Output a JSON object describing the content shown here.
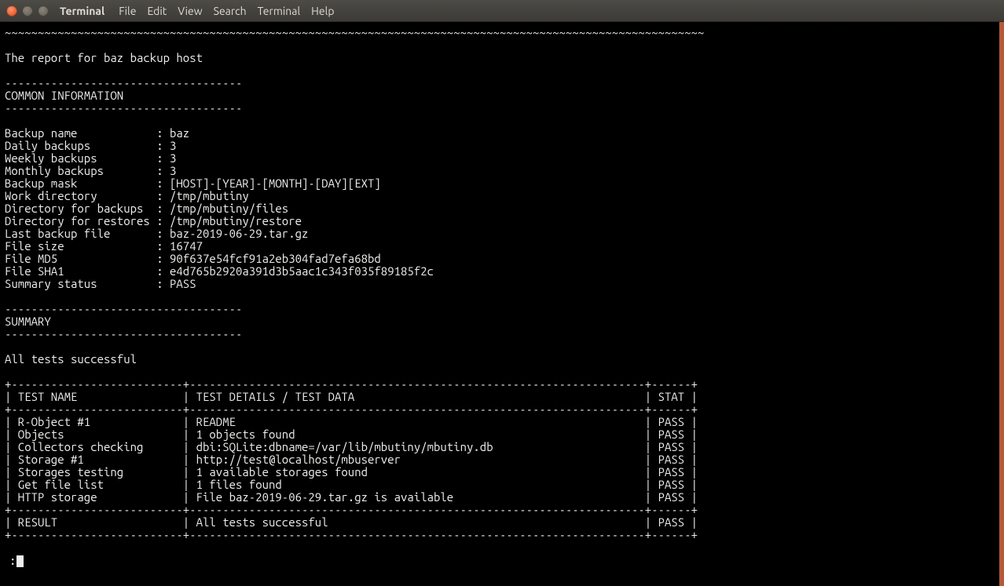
{
  "window": {
    "app_title": "Terminal",
    "menu": [
      "File",
      "Edit",
      "View",
      "Search",
      "Terminal",
      "Help"
    ]
  },
  "report": {
    "tilde_row": "~~~~~~~~~~~~~~~~~~~~~~~~~~~~~~~~~~~~~~~~~~~~~~~~~~~~~~~~~~~~~~~~~~~~~~~~~~~~~~~~~~~~~~~~~~~~~~~~~~~~~~~~~~",
    "title": "The report for baz backup host",
    "section_sep": "------------------------------------",
    "common_header": "COMMON INFORMATION",
    "common_rows": [
      {
        "label": "Backup name",
        "value": "baz"
      },
      {
        "label": "Daily backups",
        "value": "3"
      },
      {
        "label": "Weekly backups",
        "value": "3"
      },
      {
        "label": "Monthly backups",
        "value": "3"
      },
      {
        "label": "Backup mask",
        "value": "[HOST]-[YEAR]-[MONTH]-[DAY][EXT]"
      },
      {
        "label": "Work directory",
        "value": "/tmp/mbutiny"
      },
      {
        "label": "Directory for backups",
        "value": "/tmp/mbutiny/files"
      },
      {
        "label": "Directory for restores",
        "value": "/tmp/mbutiny/restore"
      },
      {
        "label": "Last backup file",
        "value": "baz-2019-06-29.tar.gz"
      },
      {
        "label": "File size",
        "value": "16747"
      },
      {
        "label": "File MD5",
        "value": "90f637e54fcf91a2eb304fad7efa68bd"
      },
      {
        "label": "File SHA1",
        "value": "e4d765b2920a391d3b5aac1c343f035f89185f2c"
      },
      {
        "label": "Summary status",
        "value": "PASS"
      }
    ],
    "summary_header": "SUMMARY",
    "summary_text": "All tests successful",
    "table": {
      "col_name": "TEST NAME",
      "col_details": "TEST DETAILS / TEST DATA",
      "col_stat": "STAT",
      "rows": [
        {
          "name": "R-Object #1",
          "details": "README",
          "stat": "PASS"
        },
        {
          "name": "Objects",
          "details": "1 objects found",
          "stat": "PASS"
        },
        {
          "name": "Collectors checking",
          "details": "dbi:SQLite:dbname=/var/lib/mbutiny/mbutiny.db",
          "stat": "PASS"
        },
        {
          "name": "Storage #1",
          "details": "http://test@localhost/mbuserver",
          "stat": "PASS"
        },
        {
          "name": "Storages testing",
          "details": "1 available storages found",
          "stat": "PASS"
        },
        {
          "name": "Get file list",
          "details": "1 files found",
          "stat": "PASS"
        },
        {
          "name": "HTTP storage",
          "details": "File baz-2019-06-29.tar.gz is available",
          "stat": "PASS"
        }
      ],
      "result_label": "RESULT",
      "result_details": "All tests successful",
      "result_stat": "PASS"
    },
    "prompt": ":"
  }
}
